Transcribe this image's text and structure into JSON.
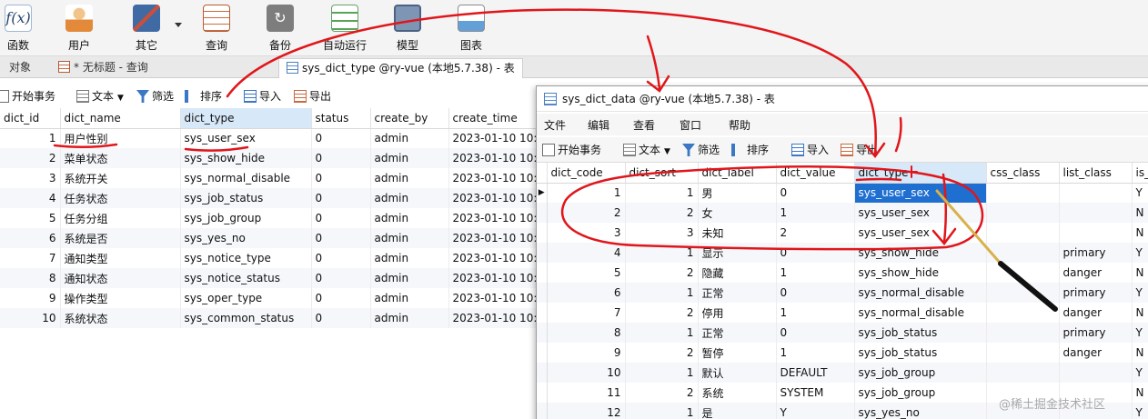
{
  "toolbar": {
    "items": [
      {
        "label": "函数",
        "icon": "function-icon"
      },
      {
        "label": "用户",
        "icon": "user-icon"
      },
      {
        "label": "其它",
        "icon": "tools-icon"
      },
      {
        "label": "查询",
        "icon": "query-icon"
      },
      {
        "label": "备份",
        "icon": "backup-icon"
      },
      {
        "label": "自动运行",
        "icon": "auto-run-icon"
      },
      {
        "label": "模型",
        "icon": "model-icon"
      },
      {
        "label": "图表",
        "icon": "chart-icon"
      }
    ],
    "function_glyph": "f(x)"
  },
  "tabs": {
    "objects": "对象",
    "query": "* 无标题 - 查询",
    "table": "sys_dict_type @ry-vue (本地5.7.38) - 表"
  },
  "subtoolbar": {
    "begin_tx": "开始事务",
    "text": "文本",
    "filter": "筛选",
    "sort": "排序",
    "import": "导入",
    "export": "导出"
  },
  "dict_type_grid": {
    "columns": [
      "dict_id",
      "dict_name",
      "dict_type",
      "status",
      "create_by",
      "create_time"
    ],
    "rows": [
      [
        "1",
        "用户性别",
        "sys_user_sex",
        "0",
        "admin",
        "2023-01-10 10:5"
      ],
      [
        "2",
        "菜单状态",
        "sys_show_hide",
        "0",
        "admin",
        "2023-01-10 10:5"
      ],
      [
        "3",
        "系统开关",
        "sys_normal_disable",
        "0",
        "admin",
        "2023-01-10 10:5"
      ],
      [
        "4",
        "任务状态",
        "sys_job_status",
        "0",
        "admin",
        "2023-01-10 10:5"
      ],
      [
        "5",
        "任务分组",
        "sys_job_group",
        "0",
        "admin",
        "2023-01-10 10:5"
      ],
      [
        "6",
        "系统是否",
        "sys_yes_no",
        "0",
        "admin",
        "2023-01-10 10:5"
      ],
      [
        "7",
        "通知类型",
        "sys_notice_type",
        "0",
        "admin",
        "2023-01-10 10:5"
      ],
      [
        "8",
        "通知状态",
        "sys_notice_status",
        "0",
        "admin",
        "2023-01-10 10:5"
      ],
      [
        "9",
        "操作类型",
        "sys_oper_type",
        "0",
        "admin",
        "2023-01-10 10:5"
      ],
      [
        "10",
        "系统状态",
        "sys_common_status",
        "0",
        "admin",
        "2023-01-10 10:5"
      ]
    ]
  },
  "dict_data_window": {
    "title": "sys_dict_data @ry-vue (本地5.7.38) - 表",
    "menu": [
      "文件",
      "编辑",
      "查看",
      "窗口",
      "帮助"
    ],
    "toolbar": {
      "begin_tx": "开始事务",
      "text": "文本",
      "filter": "筛选",
      "sort": "排序",
      "import": "导入",
      "export": "导出"
    },
    "columns": [
      "dict_code",
      "dict_sort",
      "dict_label",
      "dict_value",
      "dict_type",
      "css_class",
      "list_class",
      "is_"
    ],
    "rows": [
      [
        "1",
        "1",
        "男",
        "0",
        "sys_user_sex",
        "",
        "",
        "Y"
      ],
      [
        "2",
        "2",
        "女",
        "1",
        "sys_user_sex",
        "",
        "",
        "N"
      ],
      [
        "3",
        "3",
        "未知",
        "2",
        "sys_user_sex",
        "",
        "",
        "N"
      ],
      [
        "4",
        "1",
        "显示",
        "0",
        "sys_show_hide",
        "",
        "primary",
        "Y"
      ],
      [
        "5",
        "2",
        "隐藏",
        "1",
        "sys_show_hide",
        "",
        "danger",
        "N"
      ],
      [
        "6",
        "1",
        "正常",
        "0",
        "sys_normal_disable",
        "",
        "primary",
        "Y"
      ],
      [
        "7",
        "2",
        "停用",
        "1",
        "sys_normal_disable",
        "",
        "danger",
        "N"
      ],
      [
        "8",
        "1",
        "正常",
        "0",
        "sys_job_status",
        "",
        "primary",
        "Y"
      ],
      [
        "9",
        "2",
        "暂停",
        "1",
        "sys_job_status",
        "",
        "danger",
        "N"
      ],
      [
        "10",
        "1",
        "默认",
        "DEFAULT",
        "sys_job_group",
        "",
        "",
        "Y"
      ],
      [
        "11",
        "2",
        "系统",
        "SYSTEM",
        "sys_job_group",
        "",
        "",
        "N"
      ],
      [
        "12",
        "1",
        "是",
        "Y",
        "sys_yes_no",
        "",
        "",
        "Y"
      ]
    ],
    "selected_cell": {
      "row": 0,
      "column": "dict_type"
    }
  },
  "colors": {
    "selection": "#1f6fd1",
    "annotation": "#e0161b",
    "header_highlight": "#d7e8f8"
  },
  "watermark": "@稀土掘金技术社区"
}
